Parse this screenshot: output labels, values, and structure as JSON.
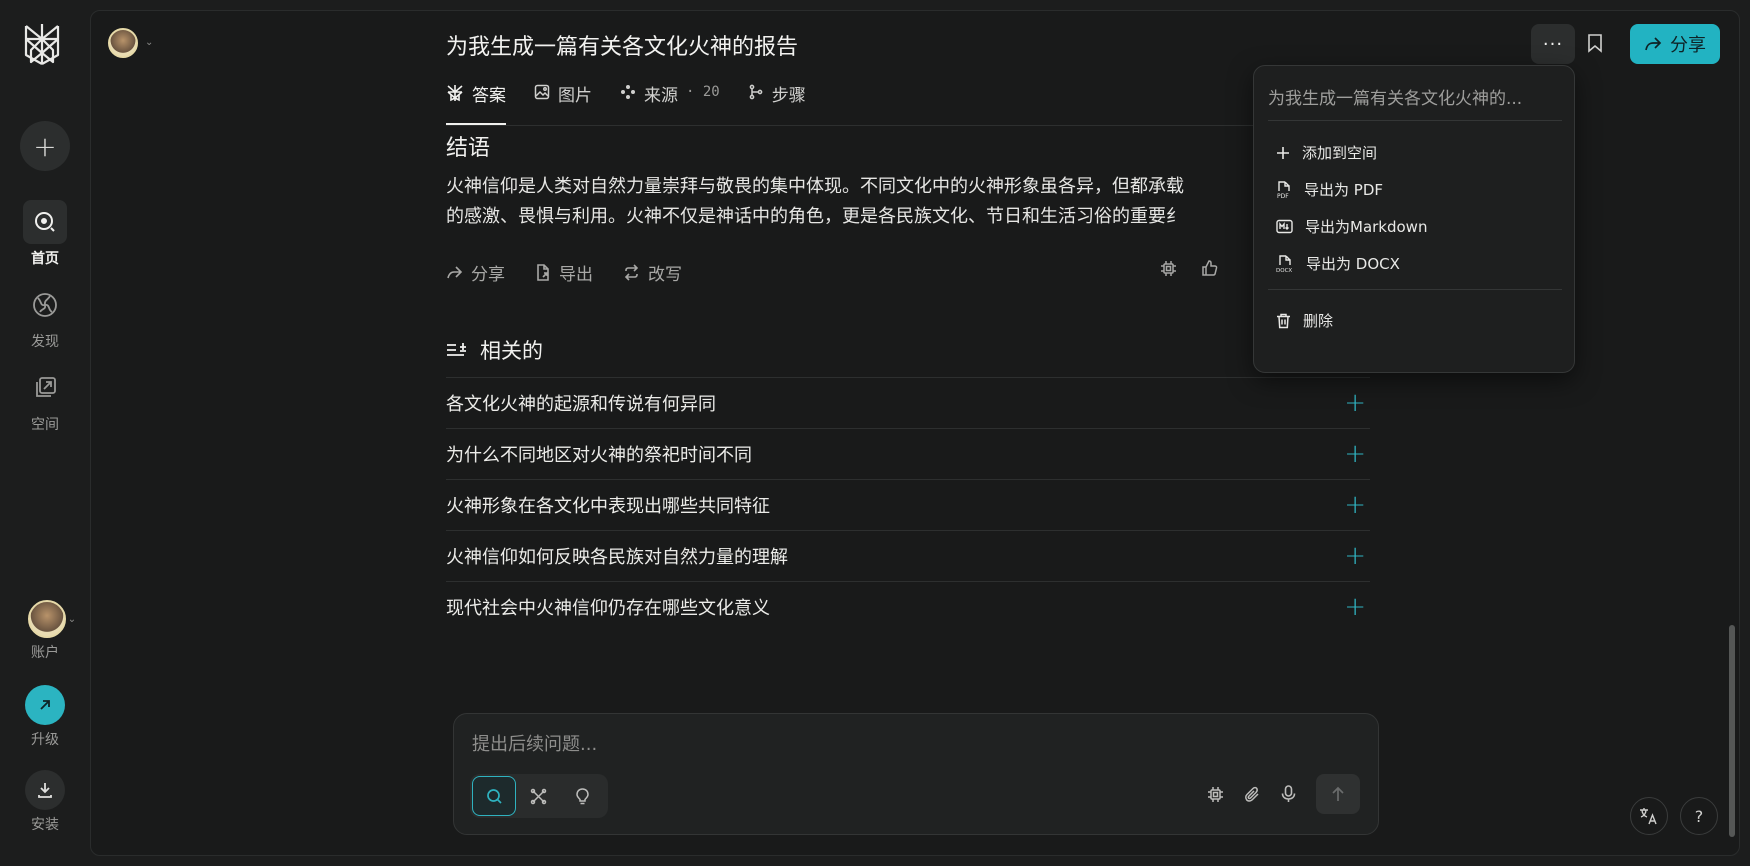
{
  "sidebar": {
    "new_thread_label": "+",
    "items": [
      {
        "label": "首页",
        "icon": "home-search-icon",
        "active": true
      },
      {
        "label": "发现",
        "icon": "globe-icon",
        "active": false
      },
      {
        "label": "空间",
        "icon": "spaces-icon",
        "active": false
      }
    ],
    "account_label": "账户",
    "upgrade_label": "升级",
    "install_label": "安装"
  },
  "header": {
    "title": "为我生成一篇有关各文化火神的报告",
    "dots_label": "···",
    "share_label": "分享"
  },
  "tabs": [
    {
      "label": "答案",
      "icon": "perplexity-icon",
      "active": true
    },
    {
      "label": "图片",
      "icon": "image-icon",
      "active": false
    },
    {
      "label": "来源",
      "count": "· 20",
      "icon": "sources-icon",
      "active": false
    },
    {
      "label": "步骤",
      "icon": "steps-icon",
      "active": false
    }
  ],
  "answer": {
    "heading": "结语",
    "lines": [
      "火神信仰是人类对自然力量崇拜与敬畏的集中体现。不同文化中的火神形象虽各异，但都承载",
      "的感激、畏惧与利用。火神不仅是神话中的角色，更是各民族文化、节日和生活习俗的重要纟"
    ],
    "actions": {
      "share": "分享",
      "export": "导出",
      "rewrite": "改写"
    }
  },
  "related": {
    "heading": "相关的",
    "items": [
      "各文化火神的起源和传说有何异同",
      "为什么不同地区对火神的祭祀时间不同",
      "火神形象在各文化中表现出哪些共同特征",
      "火神信仰如何反映各民族对自然力量的理解",
      "现代社会中火神信仰仍存在哪些文化意义"
    ]
  },
  "composer": {
    "placeholder": "提出后续问题..."
  },
  "dropdown": {
    "title": "为我生成一篇有关各文化火神的...",
    "items": [
      {
        "label": "添加到空间",
        "icon": "plus-icon"
      },
      {
        "label": "导出为 PDF",
        "icon": "pdf-file-icon"
      },
      {
        "label": "导出为Markdown",
        "icon": "markdown-icon"
      },
      {
        "label": "导出为 DOCX",
        "icon": "docx-file-icon"
      }
    ],
    "delete_label": "删除"
  },
  "colors": {
    "accent": "#22b3c2",
    "background": "#191a1a",
    "sidebar": "#1c1d1d"
  }
}
